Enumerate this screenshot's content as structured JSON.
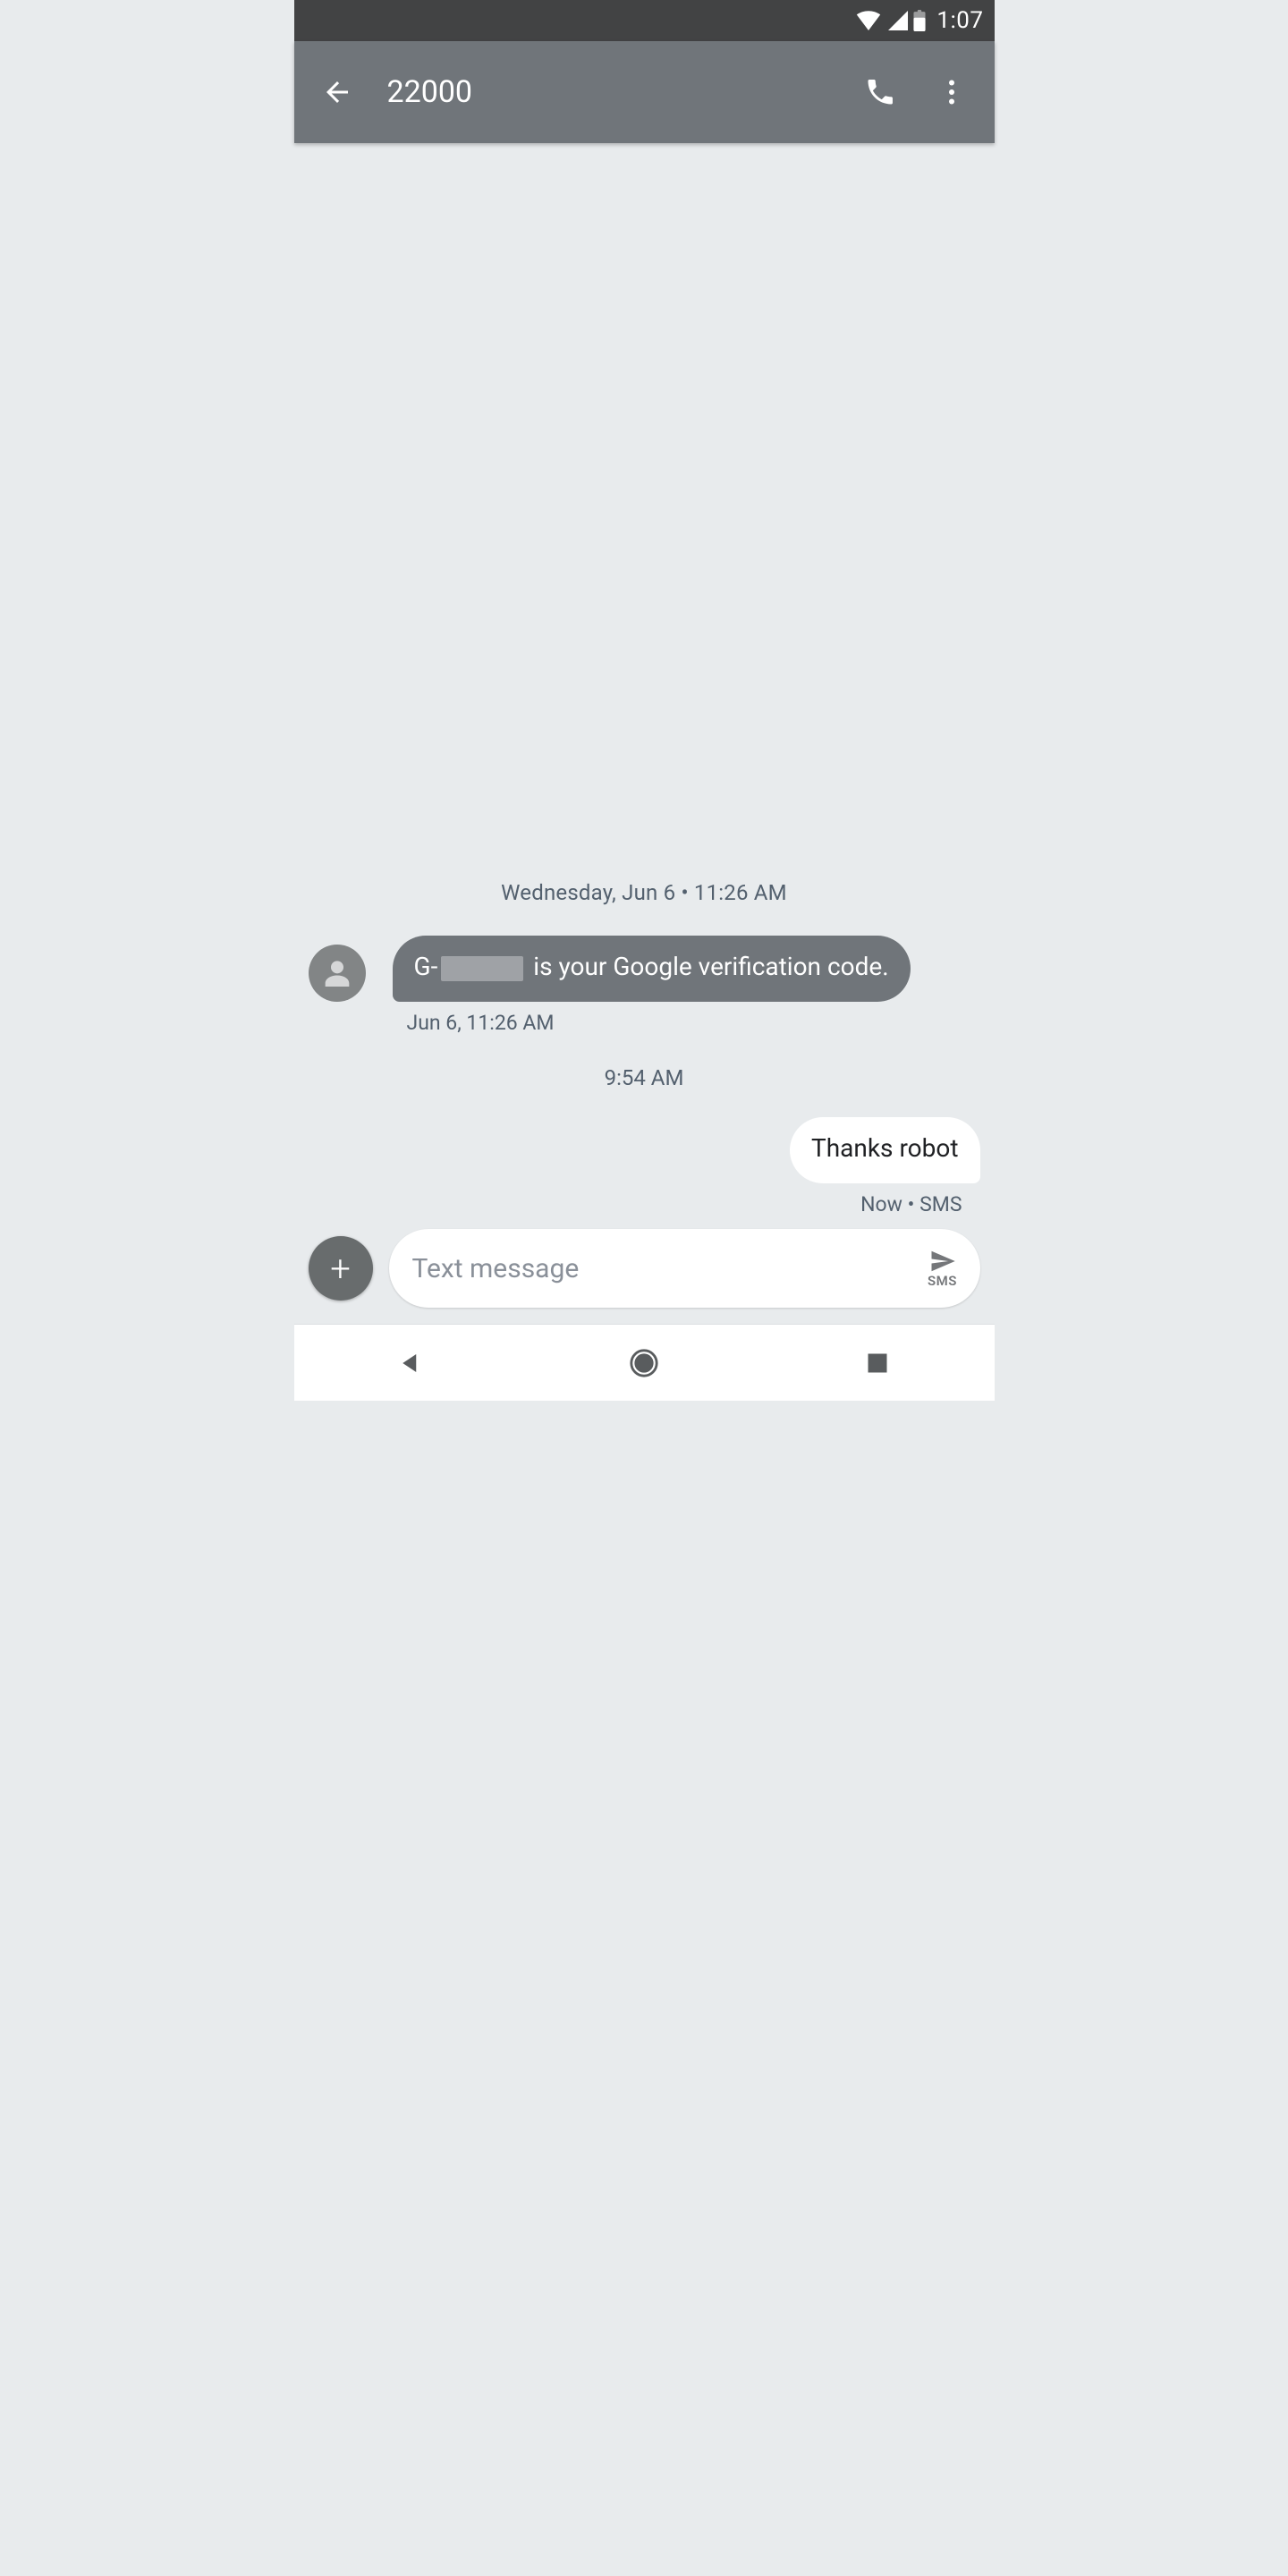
{
  "statusbar": {
    "clock": "1:07"
  },
  "appbar": {
    "title": "22000"
  },
  "conversation": {
    "date_header": "Wednesday, Jun 6 • 11:26 AM",
    "incoming": {
      "text_prefix": "G-",
      "text_suffix": " is your Google verification code.",
      "meta": "Jun 6, 11:26 AM"
    },
    "time_divider": "9:54 AM",
    "outgoing": {
      "text": "Thanks robot",
      "meta": "Now • SMS"
    }
  },
  "compose": {
    "placeholder": "Text message",
    "send_label": "SMS"
  }
}
